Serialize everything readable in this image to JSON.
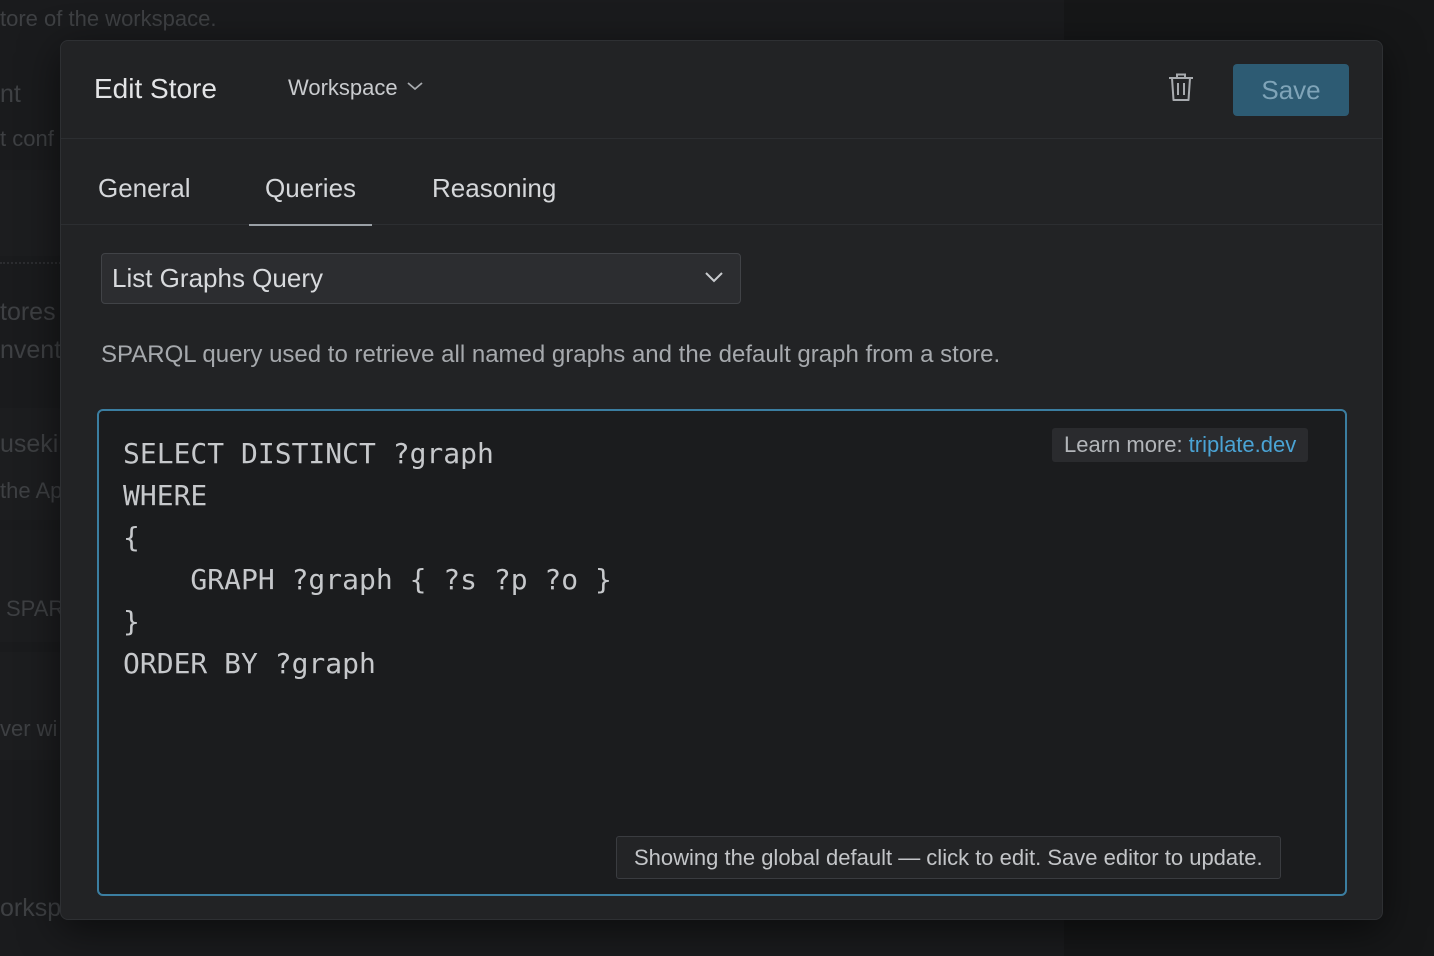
{
  "background": {
    "lines": [
      "tore of the workspace.",
      "nt",
      "t conf",
      "tores",
      "nvent",
      "useki",
      "the Ap",
      "SPAR",
      "ver wi",
      "orksp"
    ]
  },
  "dialog": {
    "title": "Edit Store",
    "scope_label": "Workspace",
    "save_label": "Save",
    "tabs": [
      {
        "label": "General",
        "active": false
      },
      {
        "label": "Queries",
        "active": true
      },
      {
        "label": "Reasoning",
        "active": false
      }
    ],
    "query_select": {
      "selected": "List Graphs Query"
    },
    "description": "SPARQL query used to retrieve all named graphs and the default graph from a store.",
    "editor": {
      "code_lines": [
        "SELECT DISTINCT ?graph",
        "WHERE",
        "{",
        "    GRAPH ?graph { ?s ?p ?o }",
        "}",
        "ORDER BY ?graph"
      ],
      "learn_more_prefix": "Learn more:",
      "learn_more_link": "triplate.dev",
      "hint": "Showing the global default — click to edit. Save editor to update."
    }
  },
  "colors": {
    "accent": "#3b7ea1",
    "save_button": "#2d5b73",
    "link": "#4aa3d4"
  },
  "icons": {
    "scope": "chevron-down-icon",
    "delete": "trash-icon",
    "select": "chevron-down-icon"
  }
}
